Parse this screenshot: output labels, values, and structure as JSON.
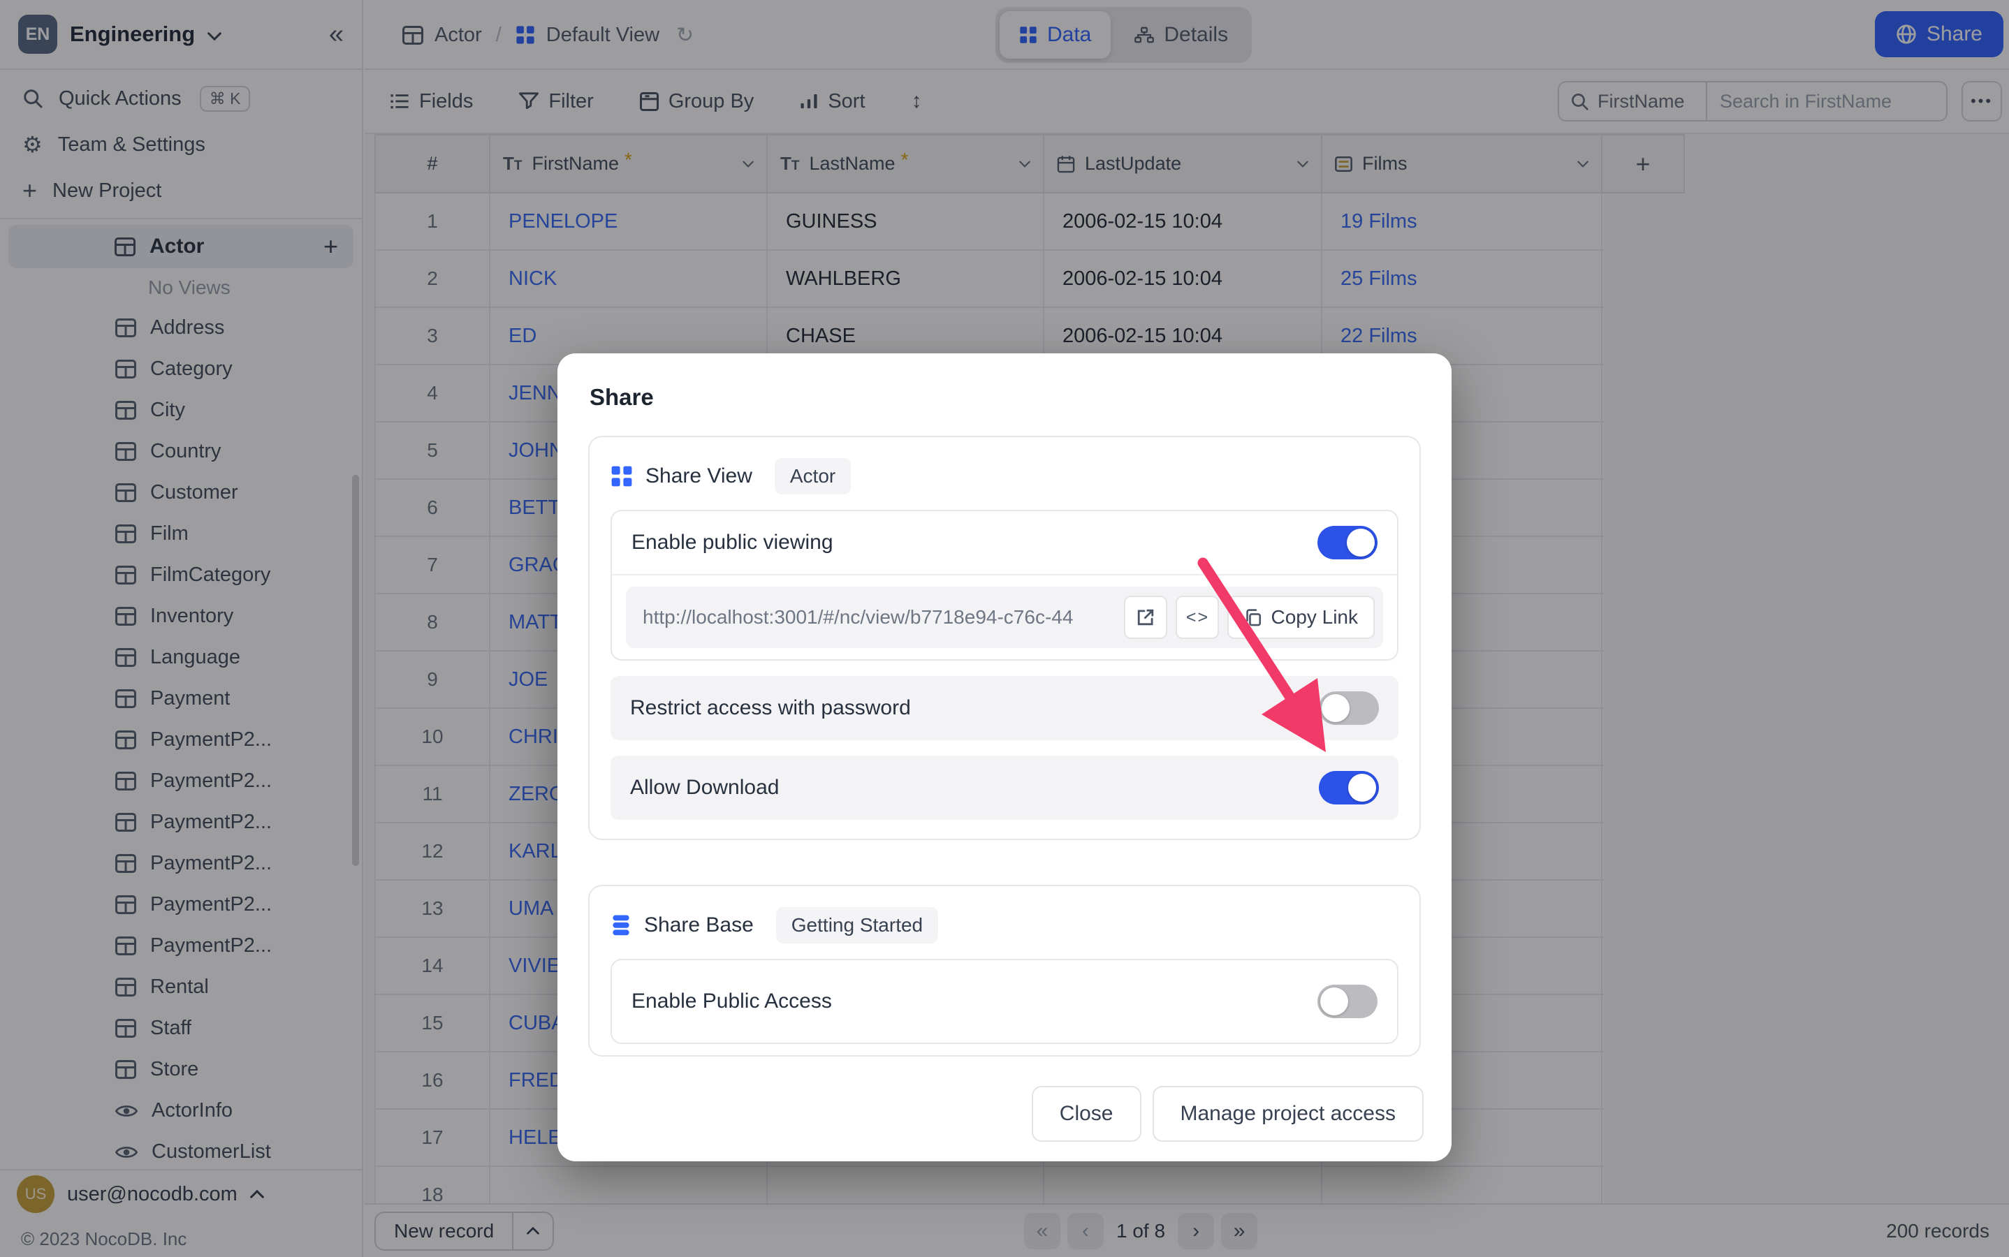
{
  "workspace": {
    "badge": "EN",
    "name": "Engineering"
  },
  "sidebar": {
    "quick_actions": "Quick Actions",
    "quick_actions_kbd": "⌘ K",
    "team_settings": "Team & Settings",
    "new_project": "New Project",
    "active_table": "Actor",
    "no_views": "No Views",
    "tables": [
      "Address",
      "Category",
      "City",
      "Country",
      "Customer",
      "Film",
      "FilmCategory",
      "Inventory",
      "Language",
      "Payment",
      "PaymentP2...",
      "PaymentP2...",
      "PaymentP2...",
      "PaymentP2...",
      "PaymentP2...",
      "PaymentP2...",
      "Rental",
      "Staff",
      "Store"
    ],
    "views": [
      {
        "label": "ActorInfo"
      },
      {
        "label": "CustomerList"
      }
    ],
    "user_email": "user@nocodb.com",
    "copyright": "© 2023 NocoDB. Inc"
  },
  "topbar": {
    "table": "Actor",
    "separator": "/",
    "view": "Default View",
    "tab_data": "Data",
    "tab_details": "Details",
    "share_button": "Share"
  },
  "toolbar": {
    "fields": "Fields",
    "filter": "Filter",
    "group_by": "Group By",
    "sort": "Sort",
    "search_field": "FirstName",
    "search_placeholder": "Search in FirstName",
    "more": "•••"
  },
  "grid": {
    "columns": [
      {
        "label": "#"
      },
      {
        "label": "FirstName",
        "required_mark": "*"
      },
      {
        "label": "LastName",
        "required_mark": "*"
      },
      {
        "label": "LastUpdate"
      },
      {
        "label": "Films"
      },
      {
        "label": "+"
      }
    ],
    "rows": [
      {
        "n": "1",
        "first": "PENELOPE",
        "last": "GUINESS",
        "updated": "2006-02-15 10:04",
        "films": "19 Films"
      },
      {
        "n": "2",
        "first": "NICK",
        "last": "WAHLBERG",
        "updated": "2006-02-15 10:04",
        "films": "25 Films"
      },
      {
        "n": "3",
        "first": "ED",
        "last": "CHASE",
        "updated": "2006-02-15 10:04",
        "films": "22 Films"
      },
      {
        "n": "4",
        "first": "JENNIFER",
        "last": "",
        "updated": "",
        "films": ""
      },
      {
        "n": "5",
        "first": "JOHNNY",
        "last": "",
        "updated": "",
        "films": ""
      },
      {
        "n": "6",
        "first": "BETTE",
        "last": "",
        "updated": "",
        "films": ""
      },
      {
        "n": "7",
        "first": "GRACE",
        "last": "",
        "updated": "",
        "films": ""
      },
      {
        "n": "8",
        "first": "MATTHEW",
        "last": "",
        "updated": "",
        "films": ""
      },
      {
        "n": "9",
        "first": "JOE",
        "last": "",
        "updated": "",
        "films": ""
      },
      {
        "n": "10",
        "first": "CHRISTIAN",
        "last": "",
        "updated": "",
        "films": ""
      },
      {
        "n": "11",
        "first": "ZERO",
        "last": "",
        "updated": "",
        "films": ""
      },
      {
        "n": "12",
        "first": "KARL",
        "last": "",
        "updated": "",
        "films": ""
      },
      {
        "n": "13",
        "first": "UMA",
        "last": "",
        "updated": "",
        "films": ""
      },
      {
        "n": "14",
        "first": "VIVIEN",
        "last": "",
        "updated": "",
        "films": ""
      },
      {
        "n": "15",
        "first": "CUBA",
        "last": "",
        "updated": "",
        "films": ""
      },
      {
        "n": "16",
        "first": "FRED",
        "last": "",
        "updated": "",
        "films": ""
      },
      {
        "n": "17",
        "first": "HELEN",
        "last": "",
        "updated": "",
        "films": ""
      },
      {
        "n": "18",
        "first": "",
        "last": "",
        "updated": "",
        "films": ""
      }
    ]
  },
  "footer": {
    "new_record": "New record",
    "first": "«",
    "prev": "‹",
    "page_info": "1 of 8",
    "next": "›",
    "last": "»",
    "records": "200 records"
  },
  "modal": {
    "title": "Share",
    "share_view": {
      "label": "Share View",
      "target": "Actor",
      "enable_public_viewing": "Enable public viewing",
      "public_viewing_on": true,
      "url": "http://localhost:3001/#/nc/view/b7718e94-c76c-44",
      "copy_link": "Copy Link",
      "restrict_password": "Restrict access with password",
      "restrict_password_on": false,
      "allow_download": "Allow Download",
      "allow_download_on": true
    },
    "share_base": {
      "label": "Share Base",
      "target": "Getting Started",
      "enable_public_access": "Enable Public Access",
      "public_access_on": false
    },
    "close": "Close",
    "manage": "Manage project access"
  },
  "colors": {
    "accent": "#3366ff",
    "toggle_on": "#2c52e8",
    "toggle_off": "#bcbcc0",
    "arrow": "#f23a68",
    "link_text": "#3a6bf5",
    "required_star": "#d9a412"
  }
}
